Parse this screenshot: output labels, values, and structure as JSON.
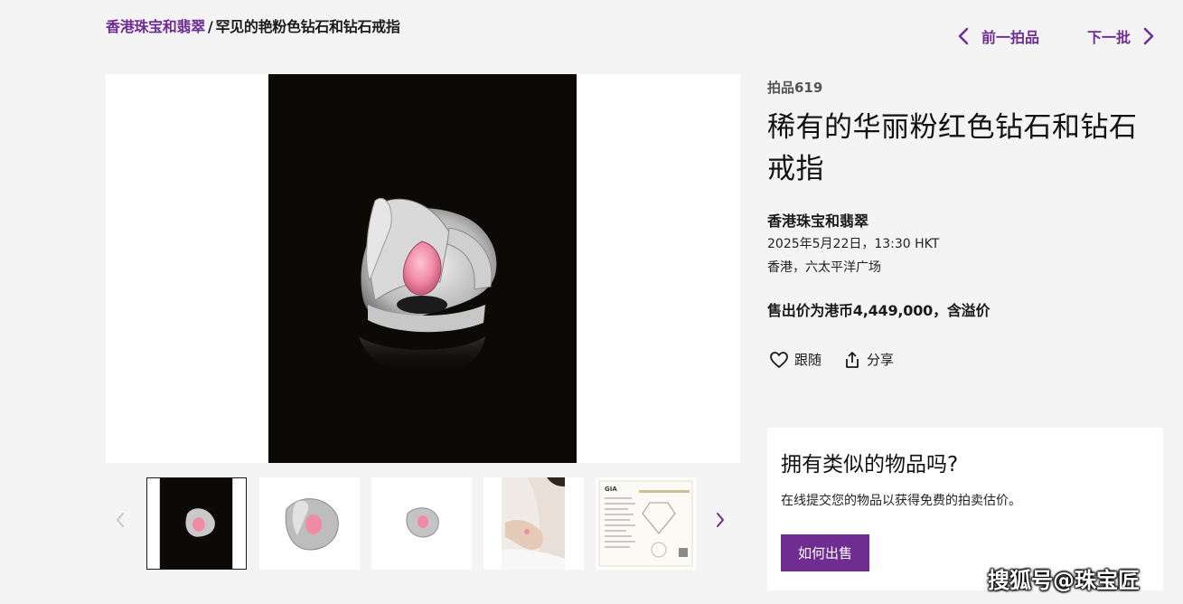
{
  "breadcrumb": {
    "parent": "香港珠宝和翡翠",
    "separator": "/",
    "current": "罕见的艳粉色钻石和钻石戒指"
  },
  "lot_nav": {
    "prev_label": "前一拍品",
    "next_label": "下一批"
  },
  "lot": {
    "number": "拍品619",
    "title": "稀有的华丽粉红色钻石和钻石戒指",
    "sale_name": "香港珠宝和翡翠",
    "date": "2025年5月22日，13:30 HKT",
    "location": "香港，六太平洋广场",
    "price": "售出价为港币4,449,000，含溢价"
  },
  "actions": {
    "follow_label": "跟随",
    "share_label": "分享"
  },
  "gallery": {
    "thumbnails": [
      "ring-front-black",
      "ring-angle-white",
      "ring-side-white",
      "ring-on-model",
      "gia-certificate"
    ],
    "active_index": 0,
    "certificate_mark": "GIA"
  },
  "sell_card": {
    "title": "拥有类似的物品吗?",
    "text": "在线提交您的物品以获得免费的拍卖估价。",
    "button_label": "如何出售"
  },
  "watermark": "搜狐号@珠宝匠",
  "colors": {
    "accent": "#6f2c91",
    "page_bg": "#f4f4f4",
    "photo_bg": "#0b0a07",
    "stone_pink": "#f08aa5"
  }
}
